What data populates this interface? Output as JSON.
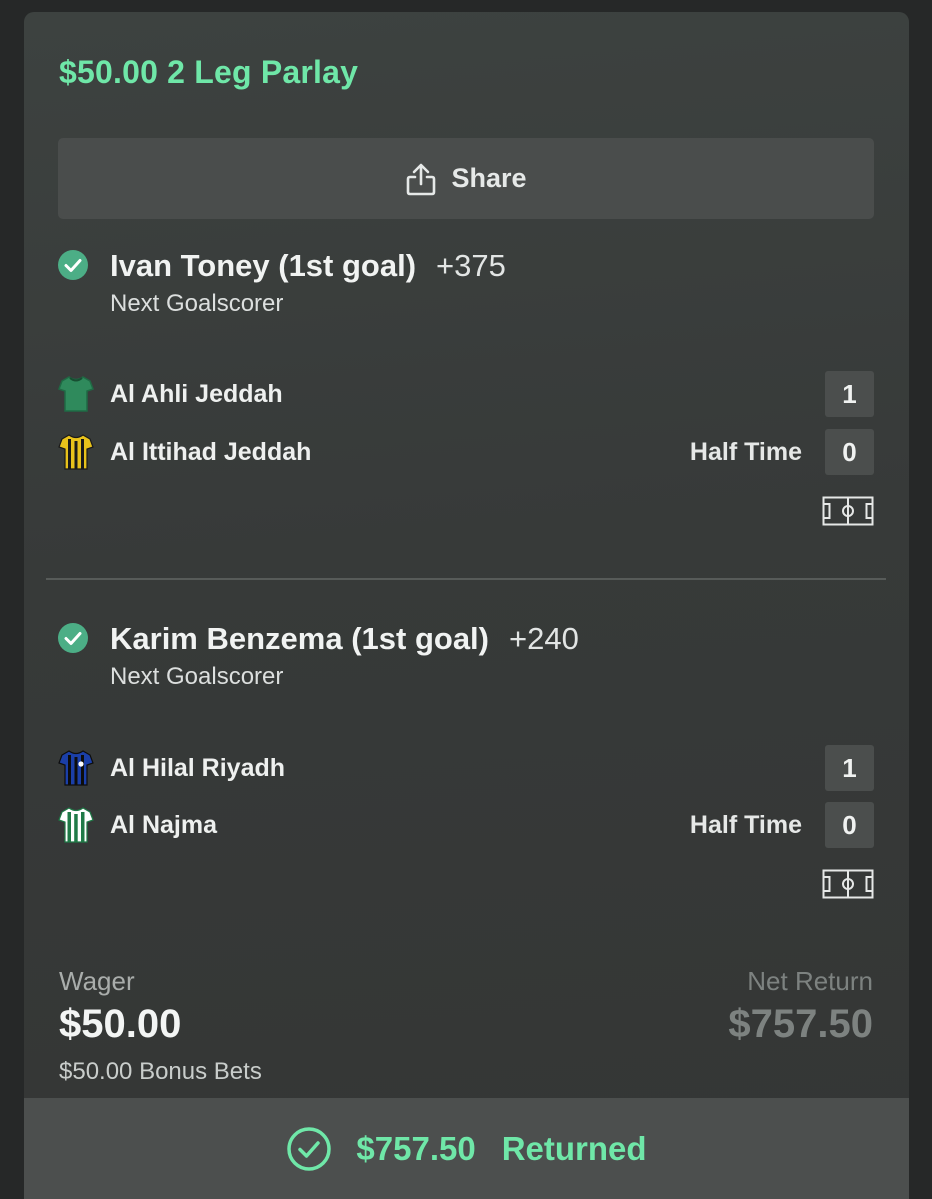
{
  "bet": {
    "title": "$50.00 2 Leg Parlay",
    "share_label": "Share"
  },
  "legs": [
    {
      "selection": "Ivan Toney (1st goal)",
      "odds": "+375",
      "market": "Next Goalscorer",
      "teams": [
        {
          "name": "Al Ahli Jeddah",
          "score": "1",
          "jersey_colors": [
            "#2f8a5c",
            "#1f6a44"
          ]
        },
        {
          "name": "Al Ittihad Jeddah",
          "score": "0",
          "jersey_colors": [
            "#e8c21b",
            "#1a1a1a"
          ]
        }
      ],
      "period": "Half Time"
    },
    {
      "selection": "Karim Benzema (1st goal)",
      "odds": "+240",
      "market": "Next Goalscorer",
      "teams": [
        {
          "name": "Al Hilal Riyadh",
          "score": "1",
          "jersey_colors": [
            "#1b3fa8",
            "#0d0d0d"
          ]
        },
        {
          "name": "Al Najma",
          "score": "0",
          "jersey_colors": [
            "#1f7a47",
            "#ffffff"
          ]
        }
      ],
      "period": "Half Time"
    }
  ],
  "summary": {
    "wager_label": "Wager",
    "wager_value": "$50.00",
    "bonus_text": "$50.00 Bonus Bets",
    "net_return_label": "Net Return",
    "net_return_value": "$757.50"
  },
  "result": {
    "amount": "$757.50",
    "status": "Returned"
  },
  "colors": {
    "accent_green": "#6fe7a8",
    "check_green": "#4cae86",
    "card_bg": "#3a3d3c",
    "score_box": "#4b4e4d"
  },
  "icons": [
    "share-icon",
    "check-circle-icon",
    "jersey-icon",
    "pitch-icon",
    "check-circle-outline-icon"
  ]
}
